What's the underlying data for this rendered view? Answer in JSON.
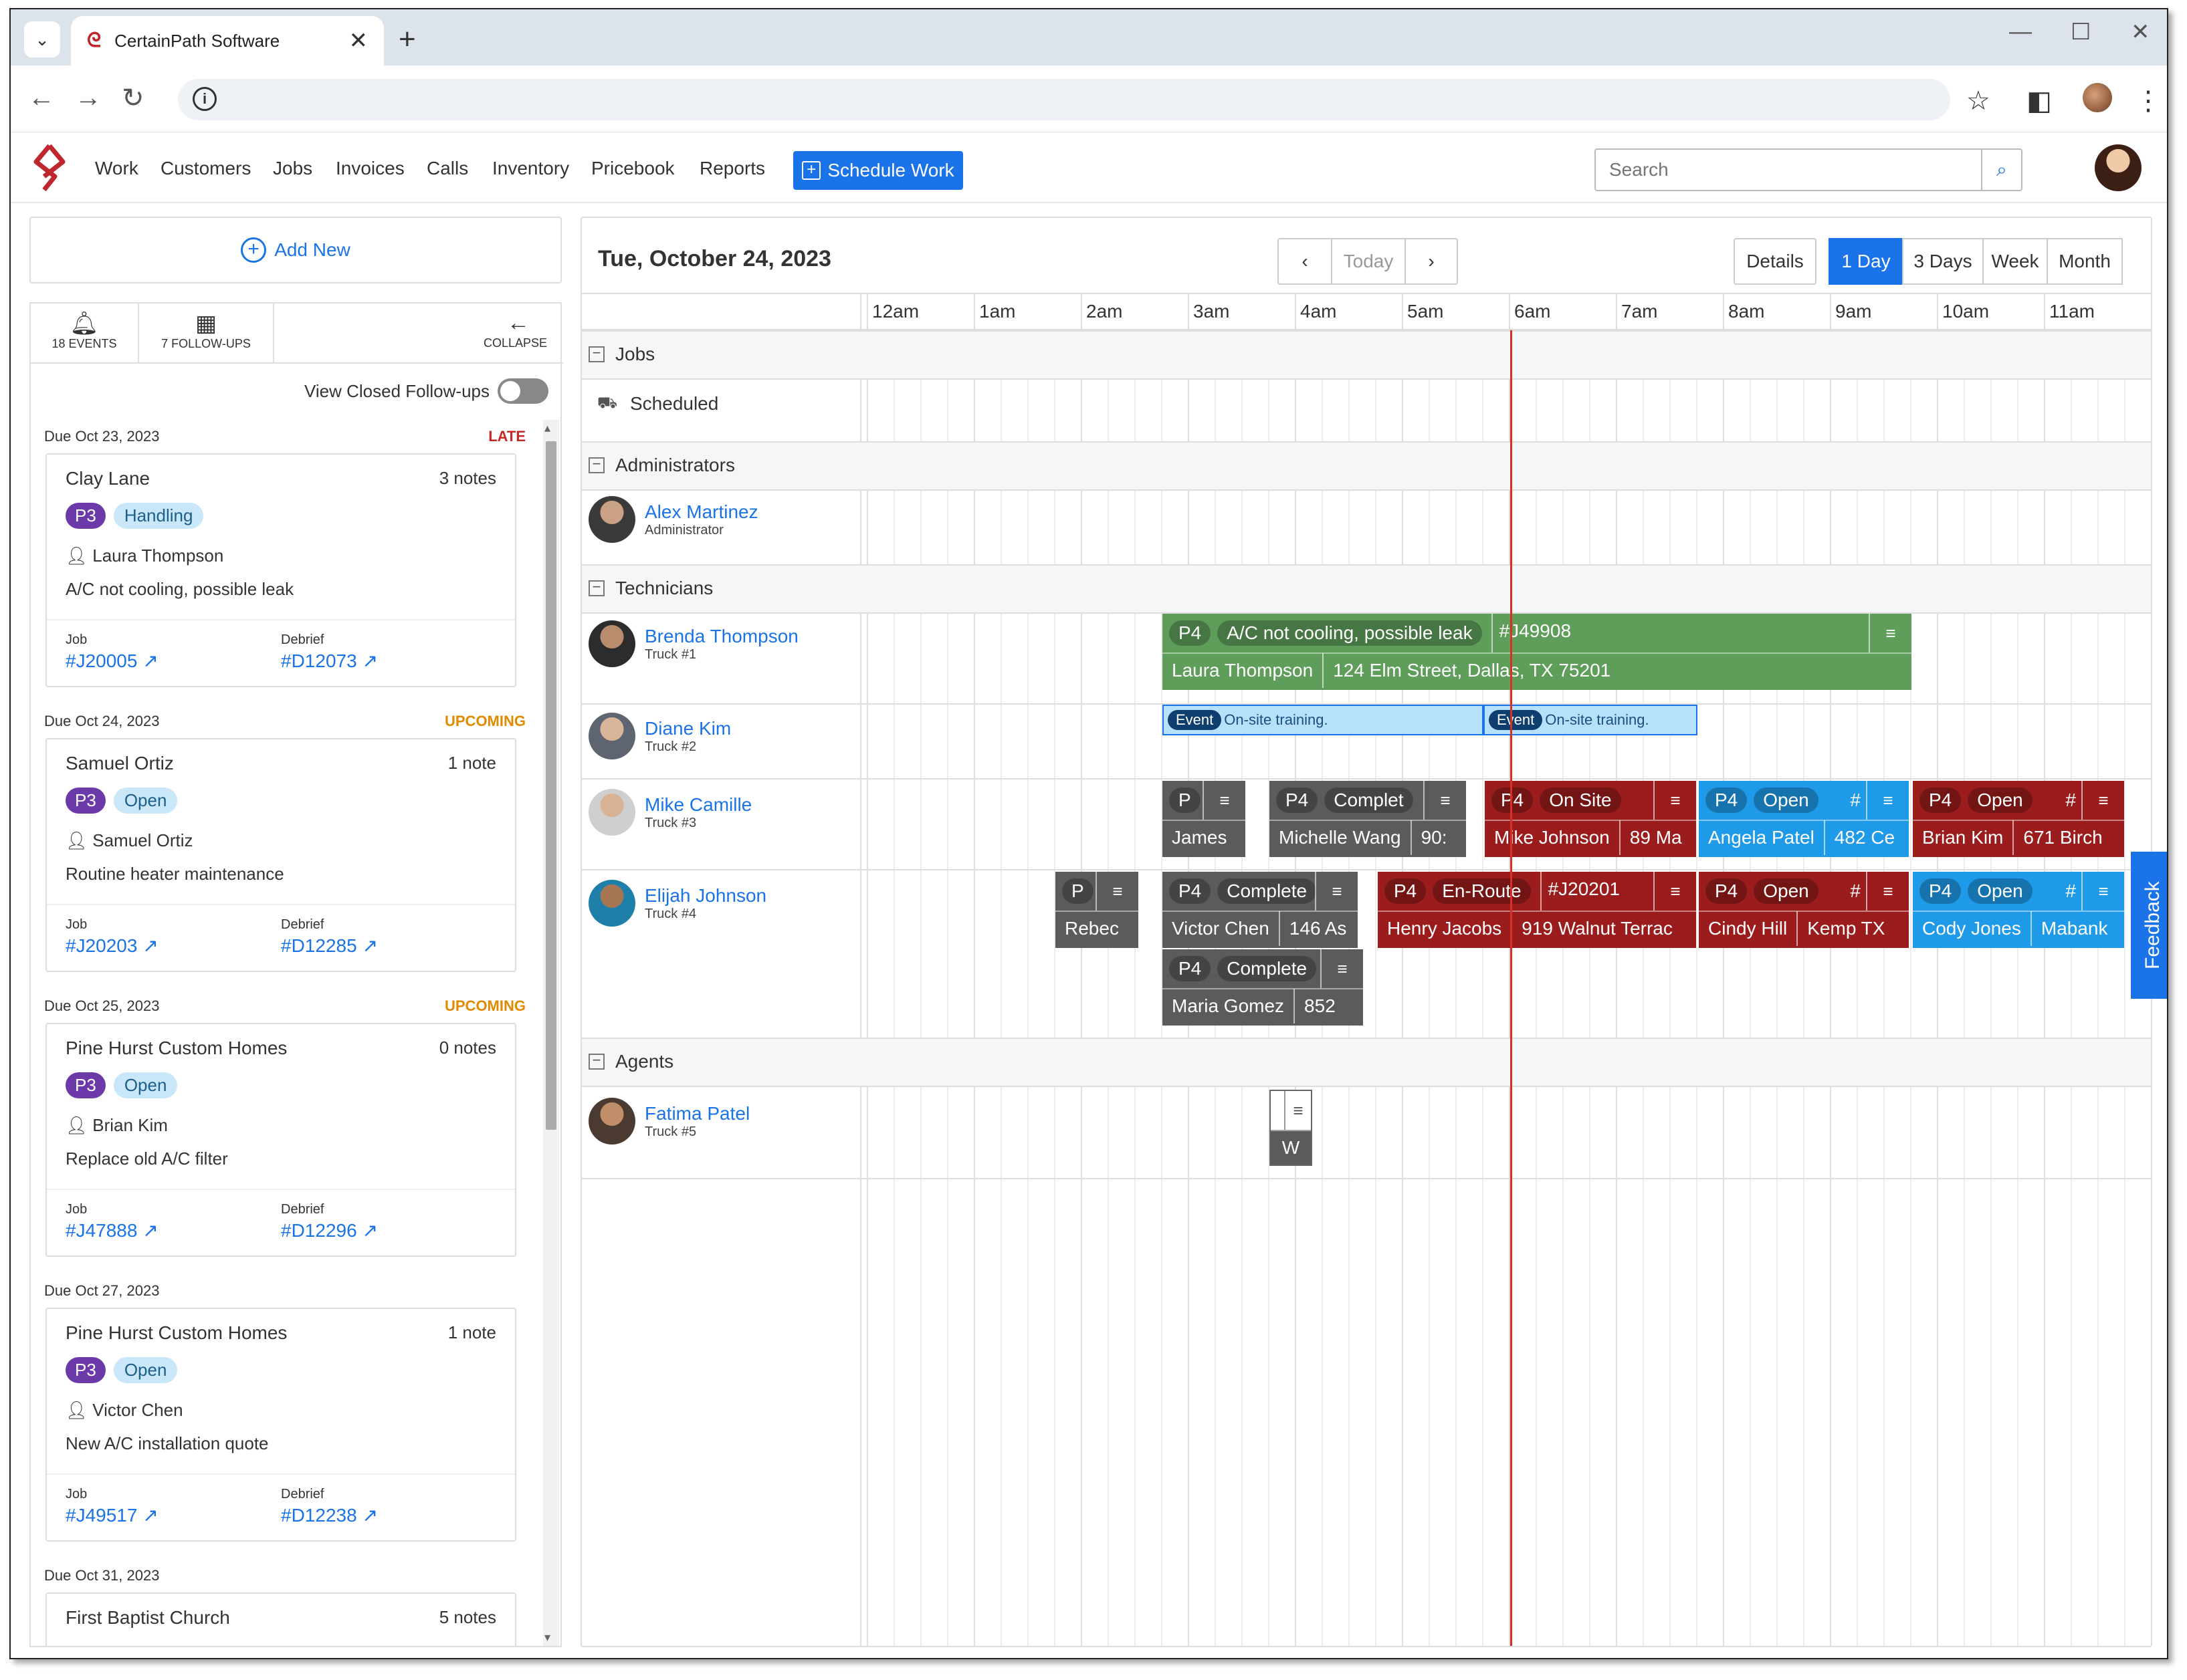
{
  "browser": {
    "tab_title": "CertainPath Software",
    "tab_close": "✕",
    "new_tab": "+",
    "win_min": "—",
    "win_max": "☐",
    "win_close": "✕"
  },
  "app": {
    "nav": [
      "Work",
      "Customers",
      "Jobs",
      "Invoices",
      "Calls",
      "Inventory",
      "Pricebook",
      "Reports"
    ],
    "schedule_btn": "Schedule Work",
    "search_placeholder": "Search",
    "brand_color": "#c0262d",
    "accent_color": "#1a73e8"
  },
  "left": {
    "add_new": "Add New",
    "tabs": {
      "events": "18 EVENTS",
      "followups": "7 FOLLOW-UPS",
      "collapse": "COLLAPSE"
    },
    "view_closed": "View Closed Follow-ups",
    "cards": [
      {
        "due": "Due Oct 23, 2023",
        "status": "LATE",
        "status_color": "#c62828",
        "name": "Clay Lane",
        "notes": "3 notes",
        "priority": "P3",
        "state": "Handling",
        "person": "Laura Thompson",
        "desc": "A/C not cooling, possible leak",
        "job_label": "Job",
        "job": "#J20005",
        "debrief_label": "Debrief",
        "debrief": "#D12073"
      },
      {
        "due": "Due Oct 24, 2023",
        "status": "UPCOMING",
        "status_color": "#e08a00",
        "name": "Samuel Ortiz",
        "notes": "1 note",
        "priority": "P3",
        "state": "Open",
        "person": "Samuel Ortiz",
        "desc": "Routine heater maintenance",
        "job_label": "Job",
        "job": "#J20203",
        "debrief_label": "Debrief",
        "debrief": "#D12285"
      },
      {
        "due": "Due Oct 25, 2023",
        "status": "UPCOMING",
        "status_color": "#e08a00",
        "name": "Pine Hurst Custom Homes",
        "notes": "0 notes",
        "priority": "P3",
        "state": "Open",
        "person": "Brian Kim",
        "desc": "Replace old A/C filter",
        "job_label": "Job",
        "job": "#J47888",
        "debrief_label": "Debrief",
        "debrief": "#D12296"
      },
      {
        "due": "Due Oct 27, 2023",
        "status": "",
        "status_color": "#333333",
        "name": "Pine Hurst Custom Homes",
        "notes": "1 note",
        "priority": "P3",
        "state": "Open",
        "person": "Victor Chen",
        "desc": "New A/C installation quote",
        "job_label": "Job",
        "job": "#J49517",
        "debrief_label": "Debrief",
        "debrief": "#D12238"
      },
      {
        "due": "Due Oct 31, 2023",
        "status": "",
        "status_color": "#333333",
        "name": "First Baptist Church",
        "notes": "5 notes"
      }
    ]
  },
  "calendar": {
    "date": "Tue, October 24, 2023",
    "today": "Today",
    "views": [
      "Details",
      "1 Day",
      "3 Days",
      "Week",
      "Month"
    ],
    "active_view": "1 Day",
    "hours": [
      "12am",
      "1am",
      "2am",
      "3am",
      "4am",
      "5am",
      "6am",
      "7am",
      "8am",
      "9am",
      "10am",
      "11am"
    ],
    "groups": {
      "jobs": "Jobs",
      "scheduled": "Scheduled",
      "administrators": "Administrators",
      "technicians": "Technicians",
      "agents": "Agents"
    },
    "resources": [
      {
        "name": "Alex Martinez",
        "sub": "Administrator"
      },
      {
        "name": "Brenda Thompson",
        "sub": "Truck #1"
      },
      {
        "name": "Diane Kim",
        "sub": "Truck #2"
      },
      {
        "name": "Mike Camille",
        "sub": "Truck #3"
      },
      {
        "name": "Elijah Johnson",
        "sub": "Truck #4"
      },
      {
        "name": "Fatima Patel",
        "sub": "Truck #5"
      }
    ],
    "events": {
      "brenda": {
        "p": "P4",
        "title": "A/C not cooling, possible leak",
        "job": "#J49908",
        "person": "Laura Thompson",
        "address": "124 Elm Street, Dallas, TX 75201"
      },
      "diane1": {
        "badge": "Event",
        "text": "On-site training."
      },
      "diane2": {
        "badge": "Event",
        "text": "On-site training."
      },
      "mike1": {
        "p": "P",
        "person": "James"
      },
      "mike2": {
        "p": "P4",
        "state": "Complet",
        "person": "Michelle Wang",
        "addr": "90:"
      },
      "mike3": {
        "p": "P4",
        "state": "On Site",
        "person": "Mike Johnson",
        "addr": "89 Ma"
      },
      "mike4": {
        "p": "P4",
        "state": "Open",
        "job": "#",
        "person": "Angela Patel",
        "addr": "482 Ce"
      },
      "mike5": {
        "p": "P4",
        "state": "Open",
        "job": "#",
        "person": "Brian Kim",
        "addr": "671 Birch"
      },
      "eli0": {
        "p": "P",
        "person": "Rebec"
      },
      "eli1": {
        "p": "P4",
        "state": "Complete",
        "person": "Victor Chen",
        "addr": "146 As"
      },
      "eli2": {
        "p": "P4",
        "state": "En-Route",
        "job": "#J20201",
        "person": "Henry Jacobs",
        "addr": "919 Walnut Terrac"
      },
      "eli3": {
        "p": "P4",
        "state": "Open",
        "job": "#",
        "person": "Cindy Hill",
        "addr": "Kemp TX"
      },
      "eli4": {
        "p": "P4",
        "state": "Open",
        "job": "#",
        "person": "Cody Jones",
        "addr": "Mabank"
      },
      "eli5": {
        "p": "P4",
        "state": "Complete",
        "person": "Maria Gomez",
        "addr": "852"
      },
      "fatima": {
        "person": "W"
      }
    },
    "feedback": "Feedback"
  }
}
